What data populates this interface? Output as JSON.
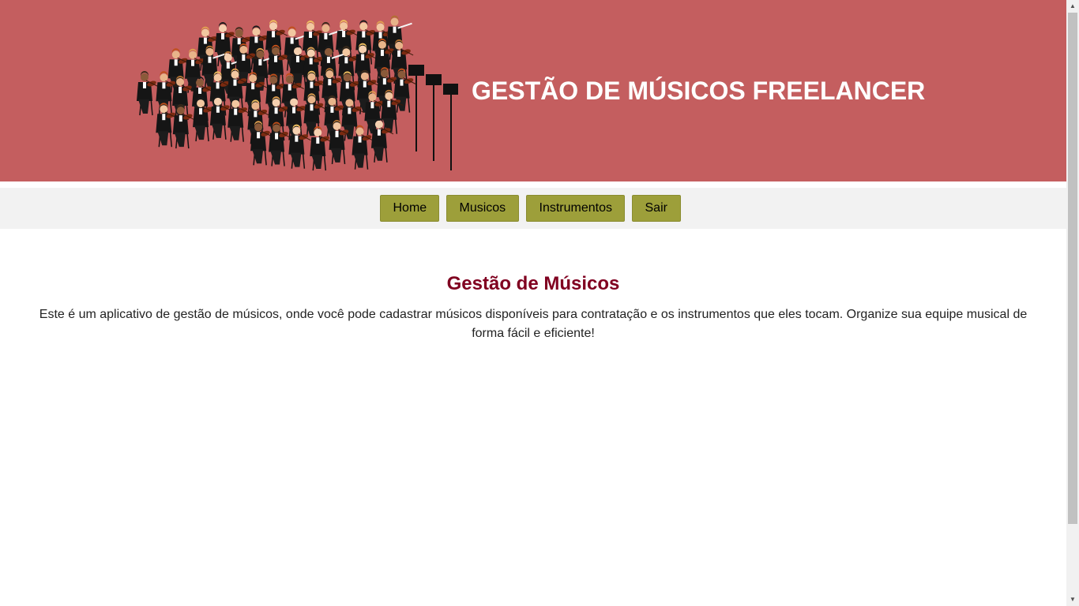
{
  "header": {
    "title": "GESTÃO DE MÚSICOS FREELANCER",
    "background_color": "#c45e5f",
    "image": "orchestra-illustration"
  },
  "nav": {
    "items": [
      {
        "label": "Home"
      },
      {
        "label": "Musicos"
      },
      {
        "label": "Instrumentos"
      },
      {
        "label": "Sair"
      }
    ],
    "button_color": "#9d9f3a"
  },
  "main": {
    "title": "Gestão de Músicos",
    "description": "Este é um aplicativo de gestão de músicos, onde você pode cadastrar músicos disponíveis para contratação e os instrumentos que eles tocam. Organize sua equipe musical de forma fácil e eficiente!",
    "title_color": "#800020"
  }
}
